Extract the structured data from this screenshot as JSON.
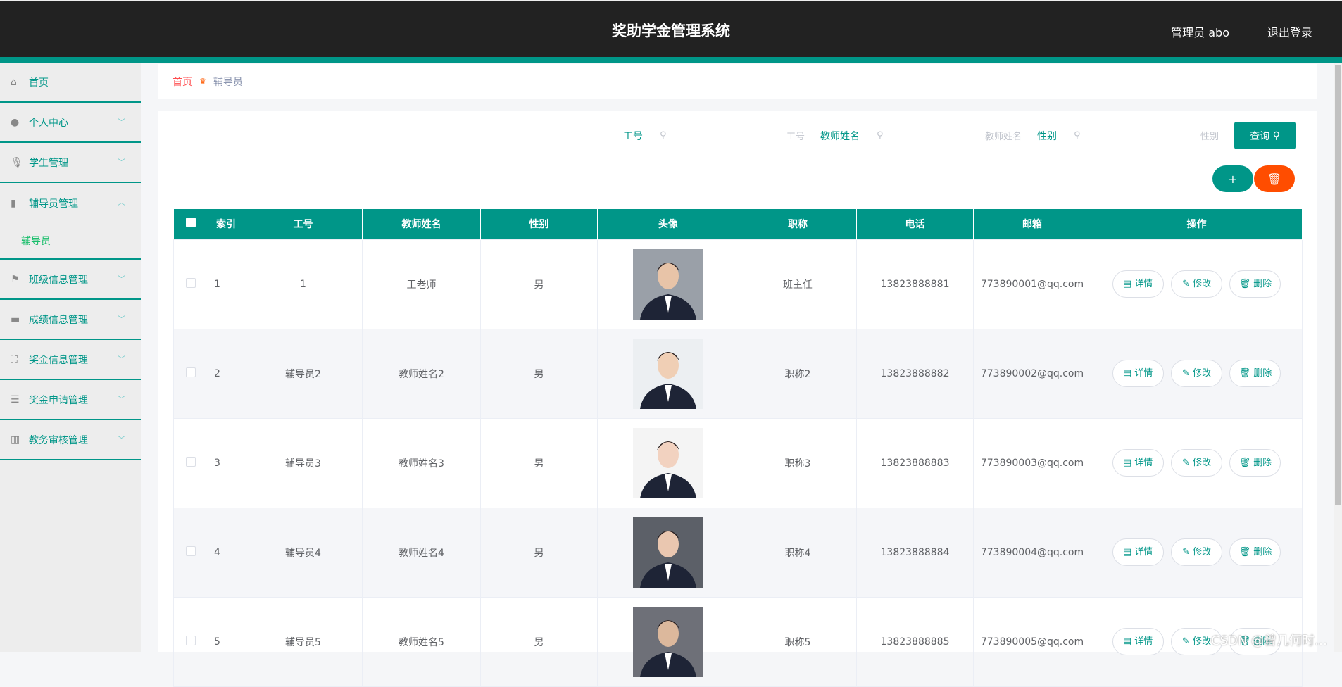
{
  "header": {
    "title": "奖助学金管理系统",
    "user": "管理员 abo",
    "logout": "退出登录"
  },
  "sidebar": {
    "items": [
      {
        "label": "首页",
        "icon": "home-icon"
      },
      {
        "label": "个人中心",
        "icon": "user-icon"
      },
      {
        "label": "学生管理",
        "icon": "microphone-icon"
      },
      {
        "label": "辅导员管理",
        "icon": "bar-chart-icon",
        "sub": "辅导员"
      },
      {
        "label": "班级信息管理",
        "icon": "flag-icon"
      },
      {
        "label": "成绩信息管理",
        "icon": "message-icon"
      },
      {
        "label": "奖金信息管理",
        "icon": "frame-icon"
      },
      {
        "label": "奖金申请管理",
        "icon": "sliders-icon"
      },
      {
        "label": "教务审核管理",
        "icon": "book-icon"
      }
    ]
  },
  "breadcrumb": {
    "home": "首页",
    "current": "辅导员"
  },
  "search": {
    "id_label": "工号",
    "id_placeholder": "工号",
    "name_label": "教师姓名",
    "name_placeholder": "教师姓名",
    "gender_label": "性别",
    "gender_placeholder": "性别",
    "query": "查询"
  },
  "actions": {
    "add": "+",
    "delete_icon": "trash-icon"
  },
  "colors": {
    "primary": "#009688",
    "danger": "#ff4d00",
    "header": "#222222"
  },
  "table": {
    "headers": [
      "索引",
      "工号",
      "教师姓名",
      "性别",
      "头像",
      "职称",
      "电话",
      "邮箱",
      "操作"
    ],
    "ops": {
      "detail": "详情",
      "edit": "修改",
      "delete": "删除"
    },
    "rows": [
      {
        "idx": "1",
        "id": "1",
        "name": "王老师",
        "gender": "男",
        "title": "班主任",
        "phone": "13823888881",
        "email": "773890001@qq.com"
      },
      {
        "idx": "2",
        "id": "辅导员2",
        "name": "教师姓名2",
        "gender": "男",
        "title": "职称2",
        "phone": "13823888882",
        "email": "773890002@qq.com"
      },
      {
        "idx": "3",
        "id": "辅导员3",
        "name": "教师姓名3",
        "gender": "男",
        "title": "职称3",
        "phone": "13823888883",
        "email": "773890003@qq.com"
      },
      {
        "idx": "4",
        "id": "辅导员4",
        "name": "教师姓名4",
        "gender": "男",
        "title": "职称4",
        "phone": "13823888884",
        "email": "773890004@qq.com"
      },
      {
        "idx": "5",
        "id": "辅导员5",
        "name": "教师姓名5",
        "gender": "男",
        "title": "职称5",
        "phone": "13823888885",
        "email": "773890005@qq.com"
      }
    ]
  },
  "watermark": "CSDN @曾几何时…"
}
